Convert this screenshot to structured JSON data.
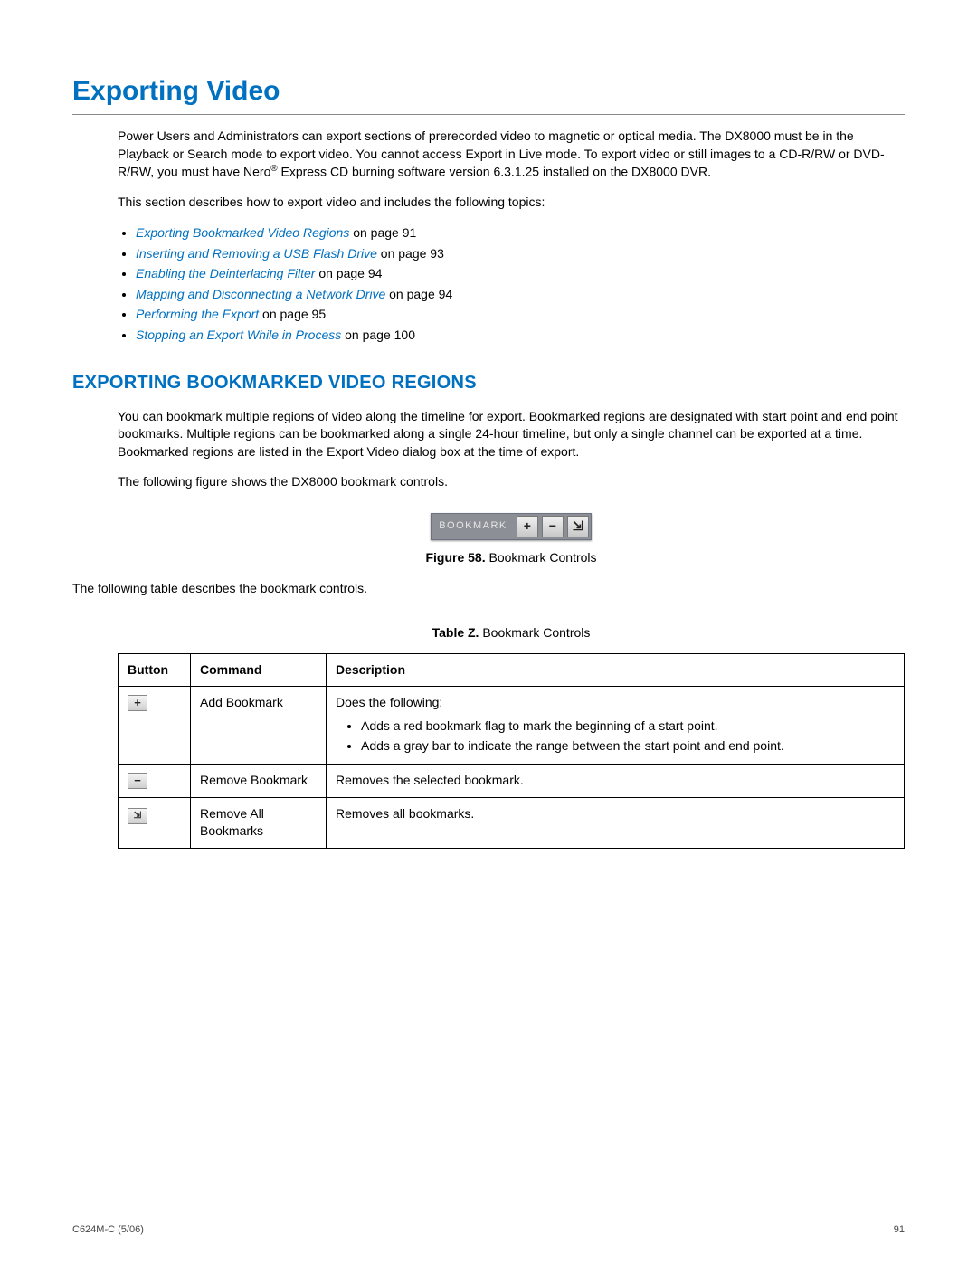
{
  "title": "Exporting Video",
  "intro_before_sup": "Power Users and Administrators can export sections of prerecorded video to magnetic or optical media. The DX8000 must be in the Playback or Search mode to export video. You cannot access Export in Live mode. To export video or still images to a CD-R/RW or DVD-R/RW, you must have Nero",
  "intro_sup": "®",
  "intro_after_sup": " Express CD burning software version 6.3.1.25 installed on the DX8000 DVR.",
  "topics_intro": "This section describes how to export video and includes the following topics:",
  "topics": [
    {
      "link": "Exporting Bookmarked Video Regions",
      "suffix": " on page 91"
    },
    {
      "link": "Inserting and Removing a USB Flash Drive",
      "suffix": " on page 93"
    },
    {
      "link": "Enabling the Deinterlacing Filter",
      "suffix": " on page 94"
    },
    {
      "link": "Mapping and Disconnecting a Network Drive",
      "suffix": " on page 94"
    },
    {
      "link": "Performing the Export",
      "suffix": " on page 95"
    },
    {
      "link": "Stopping an Export While in Process",
      "suffix": " on page 100"
    }
  ],
  "section_heading": "EXPORTING BOOKMARKED VIDEO REGIONS",
  "section_para": "You can bookmark multiple regions of video along the timeline for export. Bookmarked regions are designated with start point and end point bookmarks. Multiple regions can be bookmarked along a single 24-hour timeline, but only a single channel can be exported at a time. Bookmarked regions are listed in the Export Video dialog box at the time of export.",
  "figure_intro": "The following figure shows the DX8000 bookmark controls.",
  "bookmark_label": "BOOKMARK",
  "bm_icons": {
    "add": "+",
    "remove": "−",
    "remove_all": "⇲"
  },
  "figure_caption_prefix": "Figure 58.",
  "figure_caption_text": "  Bookmark Controls",
  "table_intro": "The following table describes the bookmark controls.",
  "table_title_prefix": "Table Z.",
  "table_title_text": "  Bookmark Controls",
  "table_headers": {
    "button": "Button",
    "command": "Command",
    "description": "Description"
  },
  "rows": [
    {
      "icon": "+",
      "command": "Add Bookmark",
      "desc_intro": "Does the following:",
      "desc_items": [
        "Adds a red bookmark flag to mark the beginning of a start point.",
        "Adds a gray bar to indicate the range between the start point and end point."
      ]
    },
    {
      "icon": "−",
      "command": "Remove Bookmark",
      "desc": "Removes the selected bookmark."
    },
    {
      "icon": "⇲",
      "command": "Remove All Bookmarks",
      "desc": "Removes all bookmarks."
    }
  ],
  "footer_left": "C624M-C (5/06)",
  "footer_right": "91"
}
